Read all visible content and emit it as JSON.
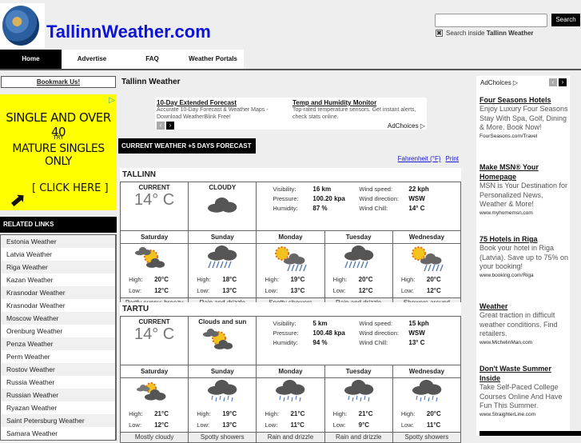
{
  "header": {
    "site_title": "TallinnWeather.com",
    "search_placeholder": "",
    "search_button": "Search",
    "search_option_prefix": "Search inside ",
    "search_option_bold": "Tallinn Weather",
    "search_option_checked": true
  },
  "nav": [
    {
      "label": "Home",
      "active": true
    },
    {
      "label": "Advertise",
      "active": false
    },
    {
      "label": "FAQ",
      "active": false
    },
    {
      "label": "Weather Portals",
      "active": false
    }
  ],
  "sidebar": {
    "bookmark": "Bookmark Us!",
    "ad": {
      "line1": "SINGLE AND OVER 40",
      "line2": "TRY",
      "line3": "MATURE SINGLES ONLY",
      "cta": "[ CLICK HERE ]"
    },
    "related_header": "RELATED LINKS",
    "related_links": [
      "Estonia Weather",
      "Latvia Weather",
      "Riga Weather",
      "Kazan Weather",
      "Krasnodar Weather",
      "Krasnodar Weather",
      "Moscow Weather",
      "Orenburg Weather",
      "Penza Weather",
      "Perm Weather",
      "Rostov Weather",
      "Russia Weather",
      "Russian Weather",
      "Ryazan Weather",
      "Saint Petersburg Weather",
      "Samara Weather"
    ]
  },
  "main": {
    "title": "Tallinn Weather",
    "ads": [
      {
        "title": "10-Day Extended Forecast",
        "desc": "Accurate 10-Day Forecast & Weather Maps - Download WeatherBlink Free!"
      },
      {
        "title": "Temp and Humidity Monitor",
        "desc": "Top-rated temperature sensors. Get instant alerts, check stats online."
      }
    ],
    "adchoices": "AdChoices",
    "forecast_header": "CURRENT WEATHER +5 DAYS FORECAST",
    "unit_link": "Fahrenheit (°F)",
    "print_link": "Print",
    "labels": {
      "current": "CURRENT",
      "visibility": "Visibility:",
      "pressure": "Pressure:",
      "humidity": "Humidity:",
      "wind_speed": "Wind speed:",
      "wind_direction": "Wind direction:",
      "wind_chill": "Wind Chill:",
      "high": "High:",
      "low": "Low:"
    },
    "cities": [
      {
        "name": "TALLINN",
        "current_temp": "14° C",
        "condition": "CLOUDY",
        "condition_icon": "cloud-icon",
        "visibility": "16 km",
        "pressure": "100.20 kpa",
        "humidity": "87 %",
        "wind_speed": "22 kph",
        "wind_direction": "WSW",
        "wind_chill": "14° C",
        "days": [
          {
            "day": "Saturday",
            "icon": "partly-sunny-icon",
            "high": "20°C",
            "low": "12°C",
            "desc": "Partly sunny; breezy"
          },
          {
            "day": "Sunday",
            "icon": "rain-icon",
            "high": "18°C",
            "low": "13°C",
            "desc": "Rain and drizzle"
          },
          {
            "day": "Monday",
            "icon": "sun-showers-icon",
            "high": "19°C",
            "low": "13°C",
            "desc": "Spotty showers"
          },
          {
            "day": "Tuesday",
            "icon": "rain-icon",
            "high": "20°C",
            "low": "12°C",
            "desc": "Rain and drizzle"
          },
          {
            "day": "Wednesday",
            "icon": "sun-showers-icon",
            "high": "20°C",
            "low": "12°C",
            "desc": "Showers around"
          }
        ]
      },
      {
        "name": "TARTU",
        "current_temp": "14° C",
        "condition": "Clouds and sun",
        "condition_icon": "partly-sunny-icon",
        "visibility": "5 km",
        "pressure": "100.48 kpa",
        "humidity": "94 %",
        "wind_speed": "15 kph",
        "wind_direction": "WSW",
        "wind_chill": "13° C",
        "days": [
          {
            "day": "Saturday",
            "icon": "mostly-cloudy-icon",
            "high": "21°C",
            "low": "12°C",
            "desc": "Mostly cloudy"
          },
          {
            "day": "Sunday",
            "icon": "showers-icon",
            "high": "19°C",
            "low": "13°C",
            "desc": "Spotty showers"
          },
          {
            "day": "Monday",
            "icon": "showers-icon",
            "high": "21°C",
            "low": "11°C",
            "desc": "Rain and drizzle"
          },
          {
            "day": "Tuesday",
            "icon": "showers-icon",
            "high": "21°C",
            "low": "9°C",
            "desc": "Rain and drizzle"
          },
          {
            "day": "Wednesday",
            "icon": "showers-icon",
            "high": "20°C",
            "low": "11°C",
            "desc": "Spotty showers"
          }
        ]
      }
    ]
  },
  "right_ads": {
    "adchoices": "AdChoices",
    "items": [
      {
        "title": "Four Seasons Hotels",
        "desc": "Enjoy Luxury Four Seasons Stay With Spa, Golf, Dining & More. Book Now!",
        "url": "FourSeasons.com/Travel"
      },
      {
        "title": "Make MSN® Your Homepage",
        "desc": "MSN is Your Destination for Personalized News, Weather & More!",
        "url": "www.myhomemsn.com"
      },
      {
        "title": "75 Hotels in Riga",
        "desc": "Book your hotel in Riga (Latvia). Save up to 75% on your booking!",
        "url": "www.booking.com/Riga"
      },
      {
        "title": "Weather",
        "desc": "Great traction in difficult weather conditions. Find retailers.",
        "url": "www.MichelinMan.com"
      },
      {
        "title": "Don't Waste Summer Inside",
        "desc": "Take Self-Paced College Courses Online And Have Fun This Summer.",
        "url": "www.StraighterLine.com"
      }
    ]
  }
}
